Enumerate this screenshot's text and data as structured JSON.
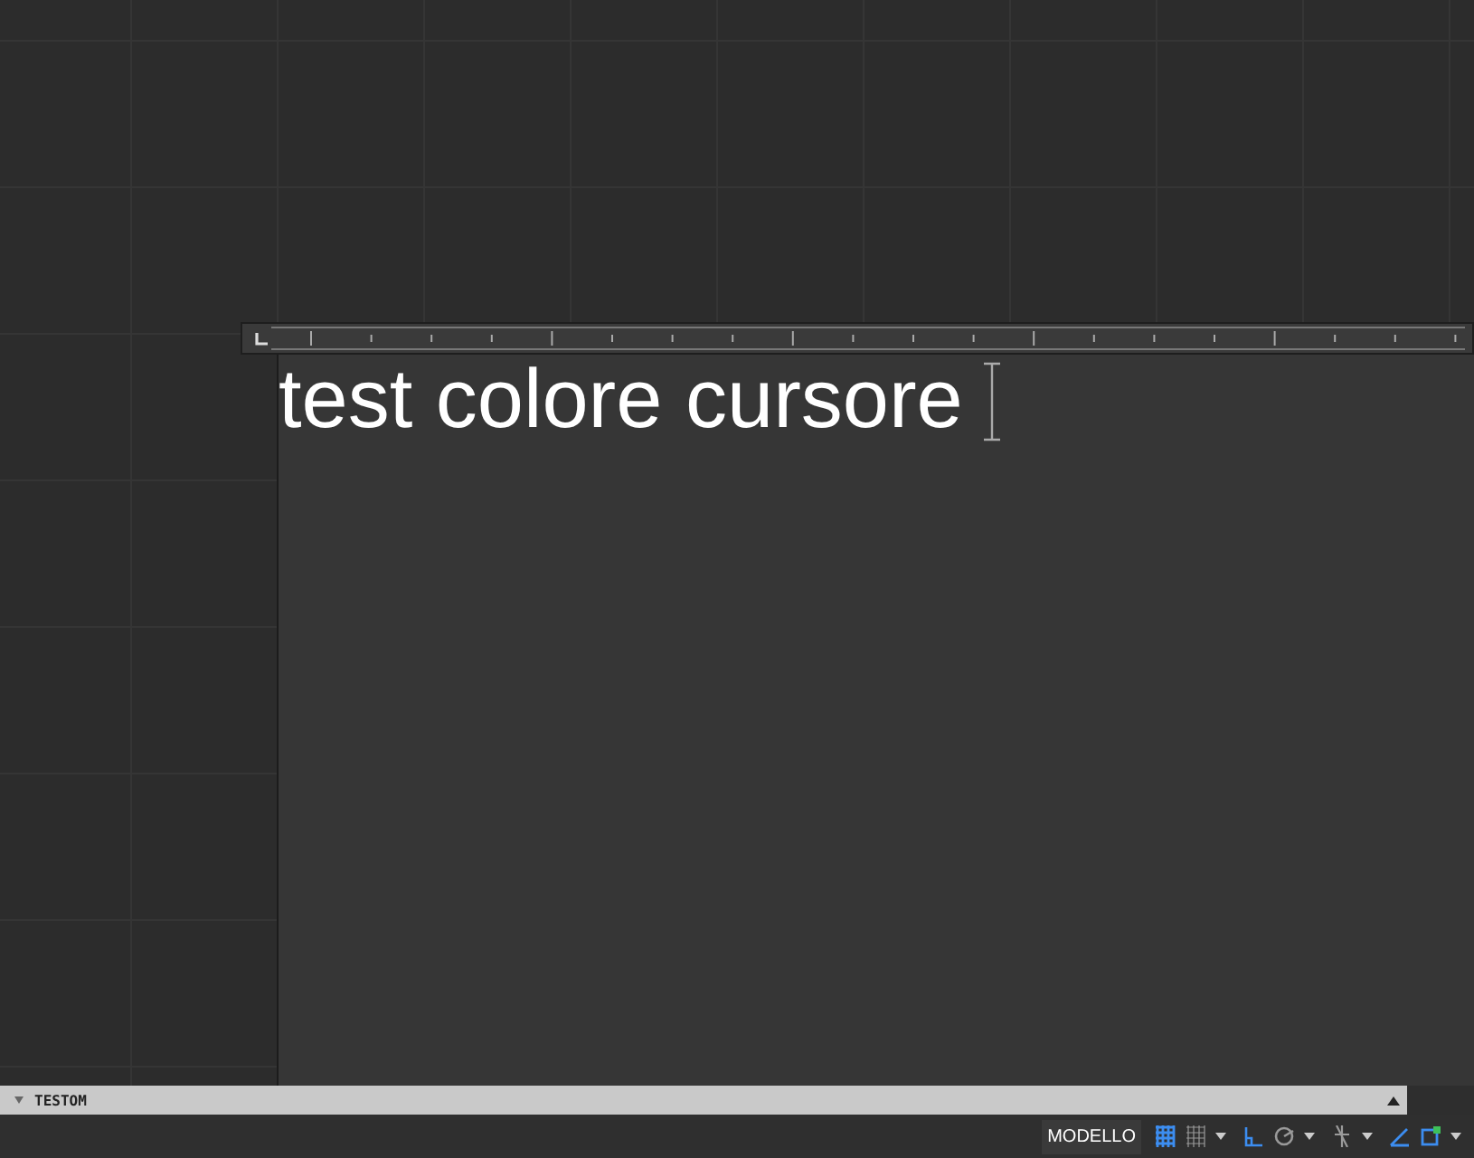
{
  "editor": {
    "text": "test colore cursore"
  },
  "command_line": {
    "text": "TESTOM"
  },
  "status_bar": {
    "model_tab": "MODELLO",
    "tools": [
      {
        "kind": "grid",
        "on": true,
        "dropdown": false
      },
      {
        "kind": "snap",
        "on": false,
        "dropdown": true
      },
      {
        "kind": "ortho",
        "on": true,
        "dropdown": false
      },
      {
        "kind": "polar",
        "on": false,
        "dropdown": true
      },
      {
        "kind": "isodraft",
        "on": false,
        "dropdown": true
      },
      {
        "kind": "track",
        "on": true,
        "dropdown": false
      },
      {
        "kind": "osnap",
        "on": true,
        "dropdown": true
      }
    ]
  }
}
